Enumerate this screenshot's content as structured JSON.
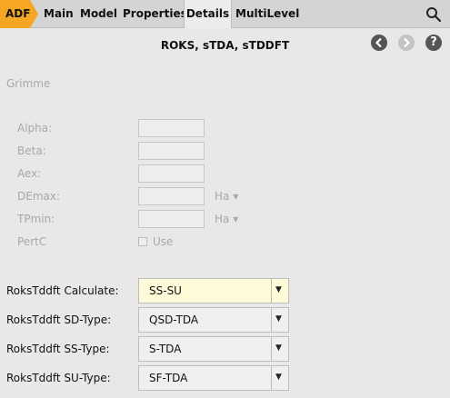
{
  "tabs": {
    "adf": "ADF",
    "main": "Main",
    "model": "Model",
    "properties": "Properties",
    "details": "Details",
    "multilevel": "MultiLevel"
  },
  "header": {
    "title": "ROKS, sTDA, sTDDFT",
    "back_icon": "chevron-left",
    "forward_icon": "chevron-right",
    "help_label": "?"
  },
  "grimme": {
    "section_label": "Grimme",
    "fields": [
      {
        "label": "Alpha:",
        "value": ""
      },
      {
        "label": "Beta:",
        "value": ""
      },
      {
        "label": "Aex:",
        "value": ""
      },
      {
        "label": "DEmax:",
        "value": "",
        "unit": "Ha ▾"
      },
      {
        "label": "TPmin:",
        "value": "",
        "unit": "Ha ▾"
      }
    ],
    "pertc_label": "PertC",
    "pertc_checkbox_label": "Use",
    "pertc_checked": false
  },
  "roks": {
    "rows": [
      {
        "label": "RoksTddft Calculate:",
        "value": "SS-SU",
        "highlighted": true
      },
      {
        "label": "RoksTddft SD-Type:",
        "value": "QSD-TDA"
      },
      {
        "label": "RoksTddft SS-Type:",
        "value": "S-TDA"
      },
      {
        "label": "RoksTddft SU-Type:",
        "value": "SF-TDA"
      }
    ]
  },
  "colors": {
    "adf_tab": "#f5a623",
    "highlight_field": "#fdfbd8",
    "nav_button": "#555555"
  }
}
